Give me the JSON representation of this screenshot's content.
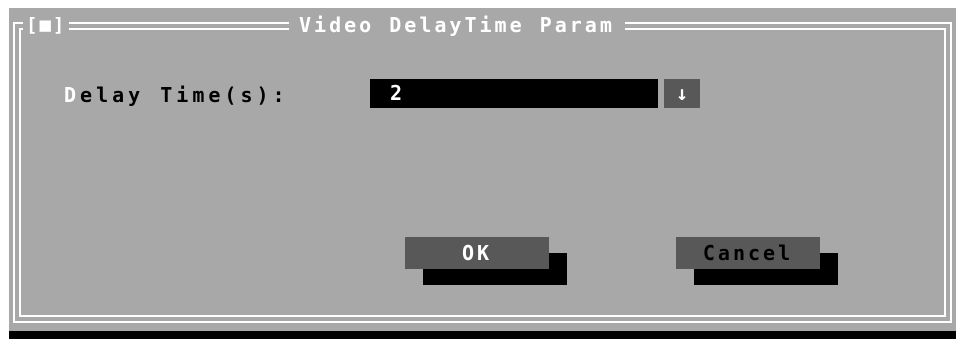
{
  "dialog": {
    "title": "Video DelayTime Param",
    "close_box": "[■]"
  },
  "field": {
    "label_hotkey": "D",
    "label_rest": "elay Time(s):",
    "value": "2",
    "dropdown_icon": "down-arrow-icon",
    "dropdown_glyph": "↓"
  },
  "buttons": {
    "ok_label": "OK",
    "cancel_label": "Cancel"
  },
  "colors": {
    "dialog_bg": "#a8a8a8",
    "frame": "#ffffff",
    "input_bg": "#000000",
    "button_bg": "#585858"
  }
}
